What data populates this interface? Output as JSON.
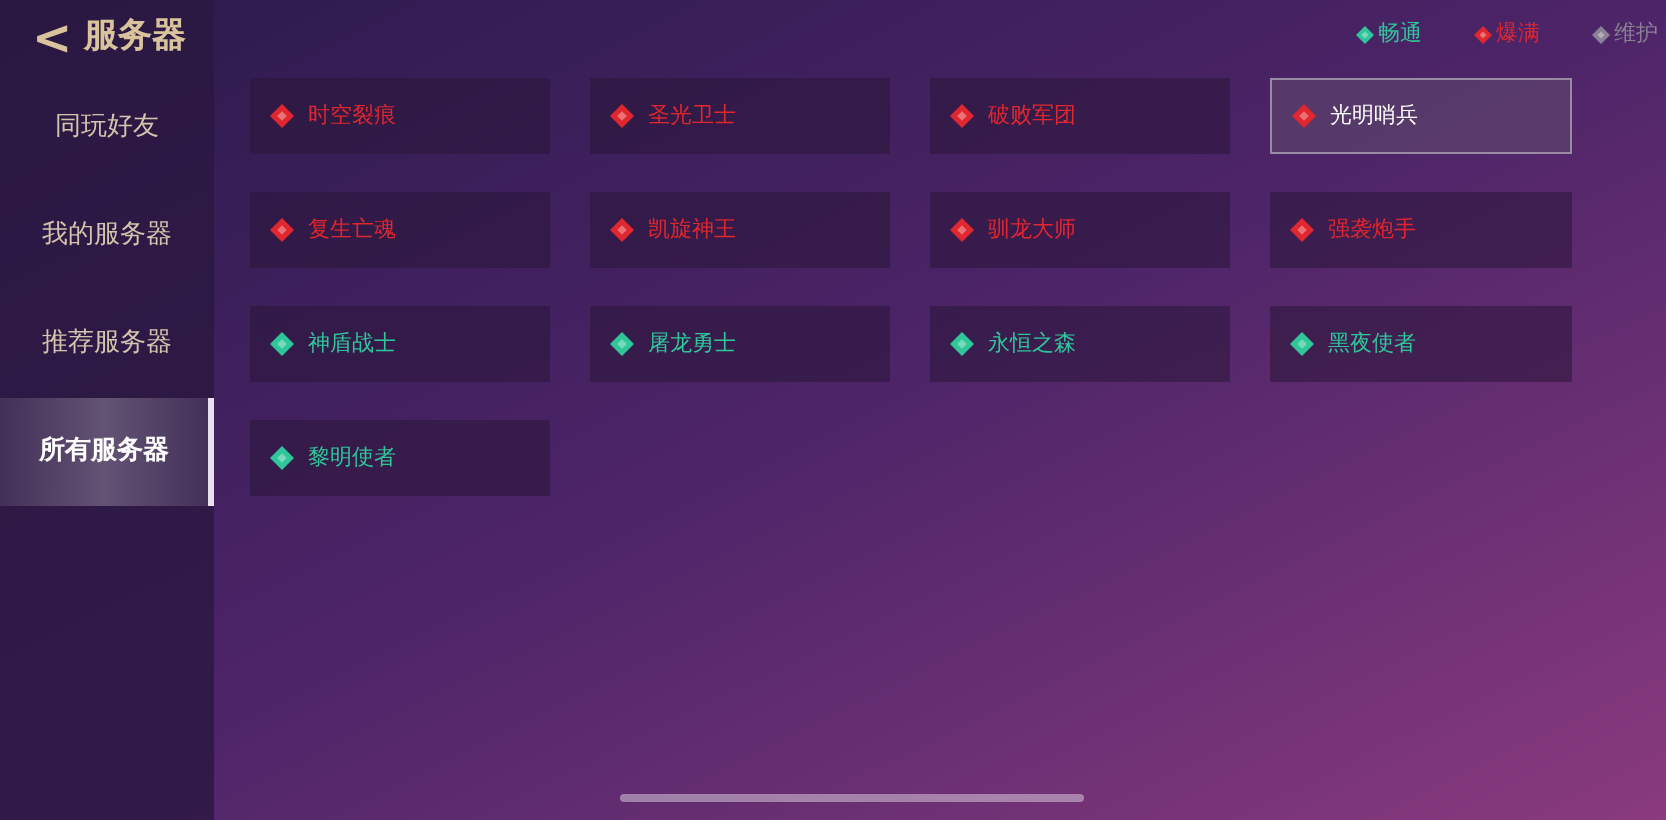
{
  "header": {
    "back": "<",
    "title": "服务器"
  },
  "sidebar": {
    "items": [
      {
        "label": "同玩好友",
        "selected": false
      },
      {
        "label": "我的服务器",
        "selected": false
      },
      {
        "label": "推荐服务器",
        "selected": false
      },
      {
        "label": "所有服务器",
        "selected": true
      }
    ]
  },
  "legend": [
    {
      "label": "畅通",
      "color": "#2fc69a"
    },
    {
      "label": "爆满",
      "color": "#e0262e"
    },
    {
      "label": "维护",
      "color": "#8a8195"
    }
  ],
  "servers": [
    {
      "name": "时空裂痕",
      "color": "#e0262e",
      "selected": false
    },
    {
      "name": "圣光卫士",
      "color": "#e0262e",
      "selected": false
    },
    {
      "name": "破败军团",
      "color": "#e0262e",
      "selected": false
    },
    {
      "name": "光明哨兵",
      "color": "#e0262e",
      "selected": true
    },
    {
      "name": "复生亡魂",
      "color": "#e0262e",
      "selected": false
    },
    {
      "name": "凯旋神王",
      "color": "#e0262e",
      "selected": false
    },
    {
      "name": "驯龙大师",
      "color": "#e0262e",
      "selected": false
    },
    {
      "name": "强袭炮手",
      "color": "#e0262e",
      "selected": false
    },
    {
      "name": "神盾战士",
      "color": "#2fc69a",
      "selected": false
    },
    {
      "name": "屠龙勇士",
      "color": "#2fc69a",
      "selected": false
    },
    {
      "name": "永恒之森",
      "color": "#2fc69a",
      "selected": false
    },
    {
      "name": "黑夜使者",
      "color": "#2fc69a",
      "selected": false
    },
    {
      "name": "黎明使者",
      "color": "#2fc69a",
      "selected": false
    }
  ]
}
